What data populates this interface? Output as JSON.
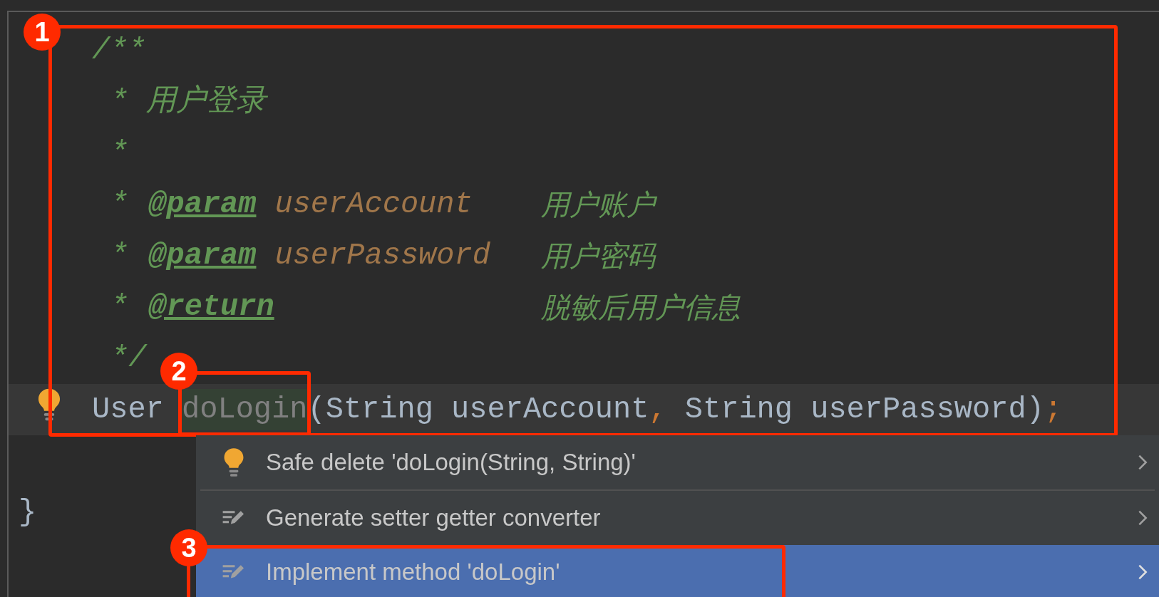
{
  "editor": {
    "annotation": "1",
    "lines": [
      {
        "kind": "doc_open",
        "text": "/**"
      },
      {
        "kind": "doc_text",
        "text": "* 用户登录"
      },
      {
        "kind": "doc_text",
        "text": "*"
      },
      {
        "kind": "doc_tag",
        "star": "*",
        "tag": "@param",
        "name": "userAccount",
        "description": "用户账户"
      },
      {
        "kind": "doc_tag",
        "star": "*",
        "tag": "@param",
        "name": "userPassword",
        "description": "用户密码"
      },
      {
        "kind": "doc_tag",
        "star": "*",
        "tag": "@return",
        "description": "脱敏后用户信息"
      },
      {
        "kind": "doc_close",
        "text": "*/"
      },
      {
        "kind": "code",
        "current": true,
        "intention": true,
        "tokens": [
          {
            "text": "User ",
            "kind": "plain"
          },
          {
            "text": "doLogin",
            "kind": "unused",
            "annotation": "2"
          },
          {
            "text": "(String userAccount",
            "kind": "plain"
          },
          {
            "text": ",",
            "kind": "punct"
          },
          {
            "text": " String userPassword)",
            "kind": "plain"
          },
          {
            "text": ";",
            "kind": "punct"
          }
        ]
      },
      {
        "kind": "blank"
      },
      {
        "kind": "brace",
        "text": "}"
      }
    ]
  },
  "intention_menu": {
    "items": [
      {
        "label": "Safe delete 'doLogin(String, String)'",
        "kind": "bulb",
        "selected": false,
        "separator_after": true
      },
      {
        "label": "Generate setter getter converter",
        "kind": "edit",
        "selected": false
      },
      {
        "label": "Implement method 'doLogin'",
        "kind": "edit",
        "selected": true,
        "annotation": "3"
      }
    ]
  }
}
